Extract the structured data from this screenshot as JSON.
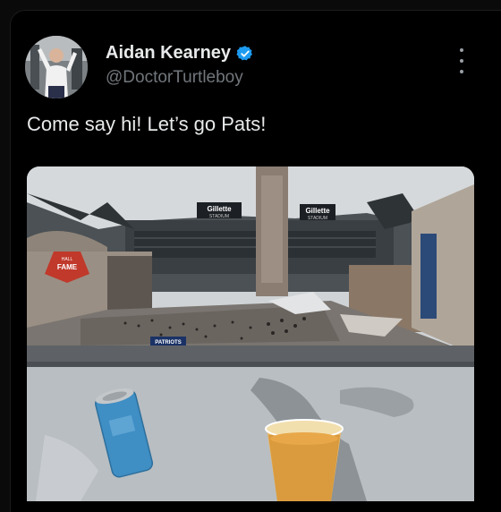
{
  "tweet": {
    "author": {
      "display_name": "Aidan Kearney",
      "handle": "@DoctorTurtleboy",
      "verified": true
    },
    "text": "Come say hi! Let’s go Pats!",
    "more_icon": "ellipsis-vertical-icon",
    "media": {
      "sign_left": "Gillette",
      "sign_left_sub": "STADIUM",
      "sign_right": "Gillette",
      "sign_right_sub": "STADIUM",
      "hof_top": "HALL",
      "hof_main": "FAME",
      "patriots_sign": "PATRIOTS"
    }
  },
  "colors": {
    "background": "#000000",
    "name": "#e7e9ea",
    "handle": "#71767b",
    "verified": "#1d9bf0"
  }
}
